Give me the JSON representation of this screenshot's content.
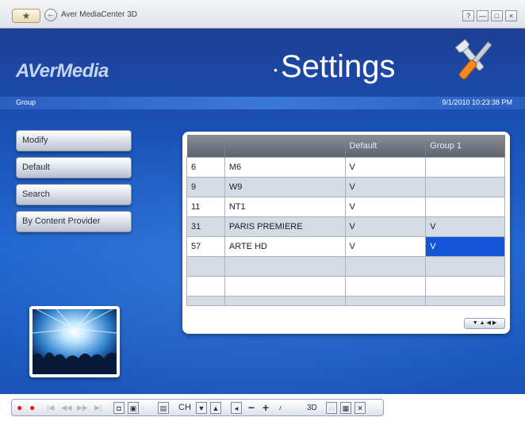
{
  "titlebar": {
    "title": "Aver MediaCenter 3D",
    "home_glyph": "★",
    "back_glyph": "←",
    "help_glyph": "?",
    "minimize_glyph": "—",
    "restore_glyph": "□",
    "close_glyph": "×"
  },
  "header": {
    "logo": "AVerMedia",
    "bullet": "•",
    "page_title": "Settings",
    "tools_icon": "tools-icon"
  },
  "info_bar": {
    "crumb": "Group",
    "datetime": "9/1/2010 10:23:38 PM"
  },
  "sidebar": {
    "items": [
      {
        "label": "Modify"
      },
      {
        "label": "Default"
      },
      {
        "label": "Search"
      },
      {
        "label": "By Content Provider"
      }
    ]
  },
  "grid": {
    "columns": [
      "",
      "",
      "Default",
      "Group 1"
    ],
    "rows": [
      {
        "num": "6",
        "name": "M6",
        "default": "V",
        "group1": ""
      },
      {
        "num": "9",
        "name": "W9",
        "default": "V",
        "group1": ""
      },
      {
        "num": "11",
        "name": "NT1",
        "default": "V",
        "group1": ""
      },
      {
        "num": "31",
        "name": "PARIS PREMIERE",
        "default": "V",
        "group1": "V"
      },
      {
        "num": "57",
        "name": "ARTE HD",
        "default": "V",
        "group1": "V"
      }
    ],
    "pager": "▼ ▲ ◀ ▶"
  },
  "playback": {
    "ch_label": "CH",
    "mode_label": "3D",
    "record_glyph": "●",
    "stop_glyph": "●",
    "up_glyph": "▲",
    "down_glyph": "▼",
    "minus_glyph": "−",
    "plus_glyph": "+",
    "vol_glyph": "◂"
  },
  "colors": {
    "background": "#1a53b8",
    "selected_cell": "#1255d6",
    "record": "#e31b1b"
  }
}
